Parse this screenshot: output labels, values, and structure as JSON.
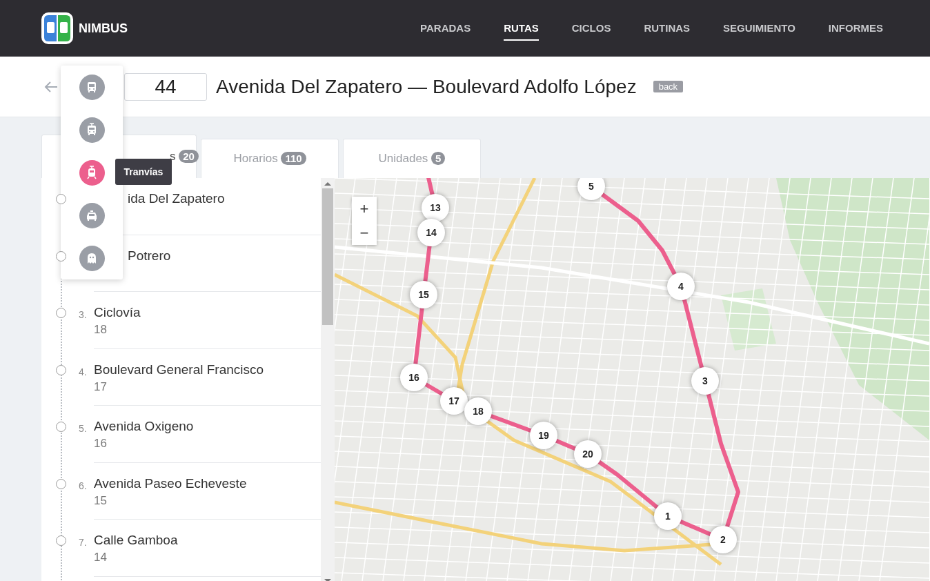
{
  "brand": "NIMBUS",
  "nav": [
    {
      "label": "PARADAS",
      "selected": false
    },
    {
      "label": "RUTAS",
      "selected": true
    },
    {
      "label": "CICLOS",
      "selected": false
    },
    {
      "label": "RUTINAS",
      "selected": false
    },
    {
      "label": "SEGUIMIENTO",
      "selected": false
    },
    {
      "label": "INFORMES",
      "selected": false
    }
  ],
  "route": {
    "number": "44",
    "title": "Avenida Del Zapatero — Boulevard Adolfo López",
    "badge": "back"
  },
  "tabs": [
    {
      "label": "s",
      "count": "20",
      "selected": true
    },
    {
      "label": "Horarios",
      "count": "110",
      "selected": false
    },
    {
      "label": "Unidades",
      "count": "5",
      "selected": false
    }
  ],
  "stops": [
    {
      "name": "ida Del Zapatero",
      "selected": false
    },
    {
      "name": "Potrero",
      "selected": false
    },
    {
      "number": "3.",
      "name": "Ciclovía",
      "sub": "18",
      "selected": false
    },
    {
      "number": "4.",
      "name": "Boulevard General Francisco",
      "sub": "17",
      "selected": false
    },
    {
      "number": "5.",
      "name": "Avenida Oxigeno",
      "sub": "16",
      "selected": false
    },
    {
      "number": "6.",
      "name": "Avenida Paseo Echeveste",
      "sub": "15",
      "selected": false
    },
    {
      "number": "7.",
      "name": "Calle Gamboa",
      "sub": "14",
      "selected": false
    }
  ],
  "vehicle_menu": [
    {
      "kind": "bus",
      "selected": false
    },
    {
      "kind": "trolleybus",
      "selected": false
    },
    {
      "kind": "tram",
      "selected": true,
      "tooltip": "Tranvías"
    },
    {
      "kind": "car",
      "selected": false
    },
    {
      "kind": "ghost",
      "selected": false
    }
  ],
  "zoom": {
    "in": "+",
    "out": "−"
  },
  "map_markers": [
    "13",
    "14",
    "15",
    "16",
    "17",
    "18",
    "19",
    "20",
    "1",
    "2",
    "3",
    "4",
    "5"
  ]
}
